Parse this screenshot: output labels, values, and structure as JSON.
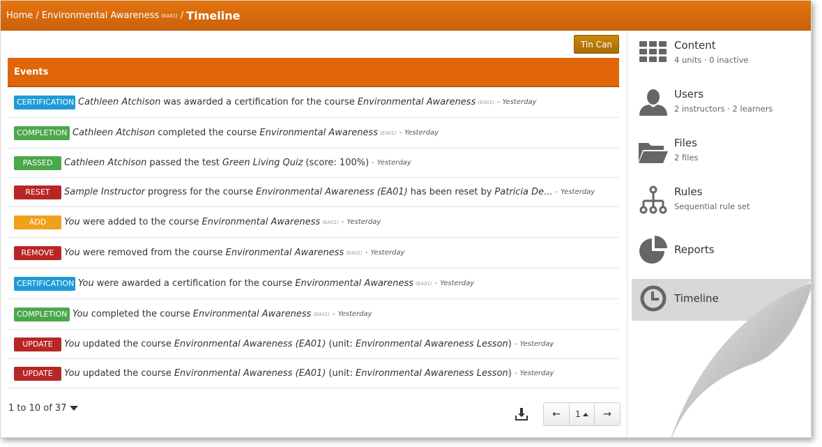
{
  "breadcrumb": {
    "home": "Home",
    "separator": "/",
    "course": "Environmental Awareness",
    "course_code": "(EA01)",
    "current": "Timeline"
  },
  "toolbar": {
    "tincan_label": "Tin Can"
  },
  "events": {
    "header": "Events",
    "rows": [
      {
        "badge": "CERTIFICATION",
        "actor": "Cathleen Atchison",
        "text": "was awarded a certification for the course",
        "object": "Environmental Awareness",
        "code": "(EA01)",
        "extra": "",
        "dash": "-",
        "when": "Yesterday"
      },
      {
        "badge": "COMPLETION",
        "actor": "Cathleen Atchison",
        "text": "completed the course",
        "object": "Environmental Awareness",
        "code": "(EA01)",
        "extra": "",
        "dash": "-",
        "when": "Yesterday"
      },
      {
        "badge": "PASSED",
        "actor": "Cathleen Atchison",
        "text": "passed the test",
        "object": "Green Living Quiz",
        "code": "",
        "extra": "(score: 100%)",
        "dash": "-",
        "when": "Yesterday"
      },
      {
        "badge": "RESET",
        "actor": "Sample Instructor",
        "text": "progress for the course",
        "object": "Environmental Awareness (EA01)",
        "text2": "has been reset by",
        "object2": "Patricia De...",
        "dash": "-",
        "when": "Yesterday"
      },
      {
        "badge": "ADD",
        "actor": "You",
        "text": "were added to the course",
        "object": "Environmental Awareness",
        "code": "(EA01)",
        "dash": "-",
        "when": "Yesterday"
      },
      {
        "badge": "REMOVE",
        "actor": "You",
        "text": "were removed from the course",
        "object": "Environmental Awareness",
        "code": "(EA01)",
        "dash": "-",
        "when": "Yesterday"
      },
      {
        "badge": "CERTIFICATION",
        "actor": "You",
        "text": "were awarded a certification for the course",
        "object": "Environmental Awareness",
        "code": "(EA01)",
        "dash": "-",
        "when": "Yesterday"
      },
      {
        "badge": "COMPLETION",
        "actor": "You",
        "text": "completed the course",
        "object": "Environmental Awareness",
        "code": "(EA01)",
        "dash": "-",
        "when": "Yesterday"
      },
      {
        "badge": "UPDATE",
        "actor": "You",
        "text": "updated the course",
        "object": "Environmental Awareness (EA01)",
        "unit_open": "(unit:",
        "unit": "Environmental Awareness Lesson",
        "unit_close": ")",
        "dash": "-",
        "when": "Yesterday"
      },
      {
        "badge": "UPDATE",
        "actor": "You",
        "text": "updated the course",
        "object": "Environmental Awareness (EA01)",
        "unit_open": "(unit:",
        "unit": "Environmental Awareness Lesson",
        "unit_close": ")",
        "dash": "-",
        "when": "Yesterday"
      }
    ]
  },
  "pagination": {
    "summary": "1 to 10 of 37",
    "prev": "←",
    "page": "1",
    "next": "→"
  },
  "sidebar": {
    "items": [
      {
        "title": "Content",
        "sub": "4 units · 0 inactive",
        "icon": "grid-icon"
      },
      {
        "title": "Users",
        "sub": "2 instructors · 2 learners",
        "icon": "user-icon"
      },
      {
        "title": "Files",
        "sub": "2 files",
        "icon": "folder-icon"
      },
      {
        "title": "Rules",
        "sub": "Sequential rule set",
        "icon": "hierarchy-icon"
      },
      {
        "title": "Reports",
        "sub": "",
        "icon": "pie-chart-icon"
      },
      {
        "title": "Timeline",
        "sub": "",
        "icon": "clock-icon"
      }
    ]
  },
  "colors": {
    "brand_orange": "#e06609",
    "certification": "#1f9ad6",
    "completion": "#4aa84a",
    "reset": "#b92626",
    "add": "#f0a01a",
    "tincan": "#b67a08"
  }
}
